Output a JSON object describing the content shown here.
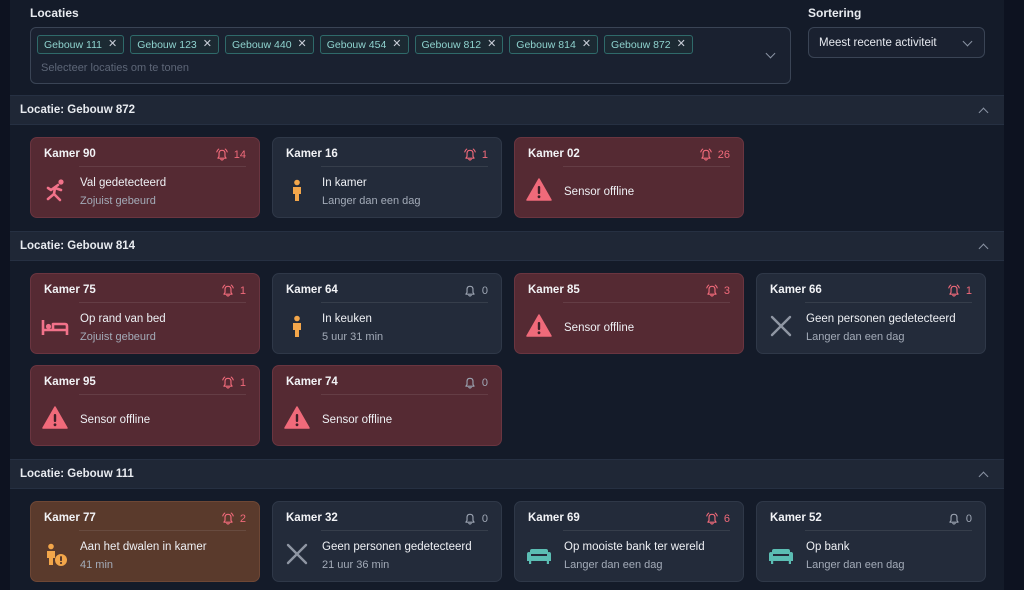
{
  "filters": {
    "locaties_label": "Locaties",
    "sortering_label": "Sortering",
    "chips": [
      "Gebouw 111",
      "Gebouw 123",
      "Gebouw 440",
      "Gebouw 454",
      "Gebouw 812",
      "Gebouw 814",
      "Gebouw 872"
    ],
    "placeholder": "Selecteer locaties om te tonen",
    "sort_value": "Meest recente activiteit"
  },
  "sections": [
    {
      "title": "Locatie: Gebouw 872",
      "cards": [
        {
          "name": "Kamer 90",
          "count": "14",
          "alarm": true,
          "style": "alert",
          "icon": "fall",
          "line1": "Val gedetecteerd",
          "line2": "Zojuist gebeurd"
        },
        {
          "name": "Kamer 16",
          "count": "1",
          "alarm": true,
          "style": "normal",
          "icon": "person",
          "line1": "In kamer",
          "line2": "Langer dan een dag"
        },
        {
          "name": "Kamer 02",
          "count": "26",
          "alarm": true,
          "style": "alert",
          "icon": "warning",
          "line1": "Sensor offline",
          "line2": ""
        }
      ]
    },
    {
      "title": "Locatie: Gebouw 814",
      "cards": [
        {
          "name": "Kamer 75",
          "count": "1",
          "alarm": true,
          "style": "alert",
          "icon": "bed",
          "line1": "Op rand van bed",
          "line2": "Zojuist gebeurd"
        },
        {
          "name": "Kamer 64",
          "count": "0",
          "alarm": false,
          "style": "normal",
          "icon": "person",
          "line1": "In keuken",
          "line2": "5 uur 31 min"
        },
        {
          "name": "Kamer 85",
          "count": "3",
          "alarm": true,
          "style": "alert",
          "icon": "warning",
          "line1": "Sensor offline",
          "line2": ""
        },
        {
          "name": "Kamer 66",
          "count": "1",
          "alarm": true,
          "style": "normal",
          "icon": "cross",
          "line1": "Geen personen gedetecteerd",
          "line2": "Langer dan een dag"
        },
        {
          "name": "Kamer 95",
          "count": "1",
          "alarm": true,
          "style": "alert",
          "icon": "warning",
          "line1": "Sensor offline",
          "line2": ""
        },
        {
          "name": "Kamer 74",
          "count": "0",
          "alarm": false,
          "style": "alert",
          "icon": "warning",
          "line1": "Sensor offline",
          "line2": ""
        }
      ]
    },
    {
      "title": "Locatie: Gebouw 111",
      "cards": [
        {
          "name": "Kamer 77",
          "count": "2",
          "alarm": true,
          "style": "warn",
          "icon": "wander",
          "line1": "Aan het dwalen in kamer",
          "line2": "41 min"
        },
        {
          "name": "Kamer 32",
          "count": "0",
          "alarm": false,
          "style": "normal",
          "icon": "cross",
          "line1": "Geen personen gedetecteerd",
          "line2": "21 uur 36 min"
        },
        {
          "name": "Kamer 69",
          "count": "6",
          "alarm": true,
          "style": "normal",
          "icon": "sofa",
          "line1": "Op mooiste bank ter wereld",
          "line2": "Langer dan een dag"
        },
        {
          "name": "Kamer 52",
          "count": "0",
          "alarm": false,
          "style": "normal",
          "icon": "sofa",
          "line1": "Op bank",
          "line2": "Langer dan een dag"
        }
      ]
    }
  ]
}
